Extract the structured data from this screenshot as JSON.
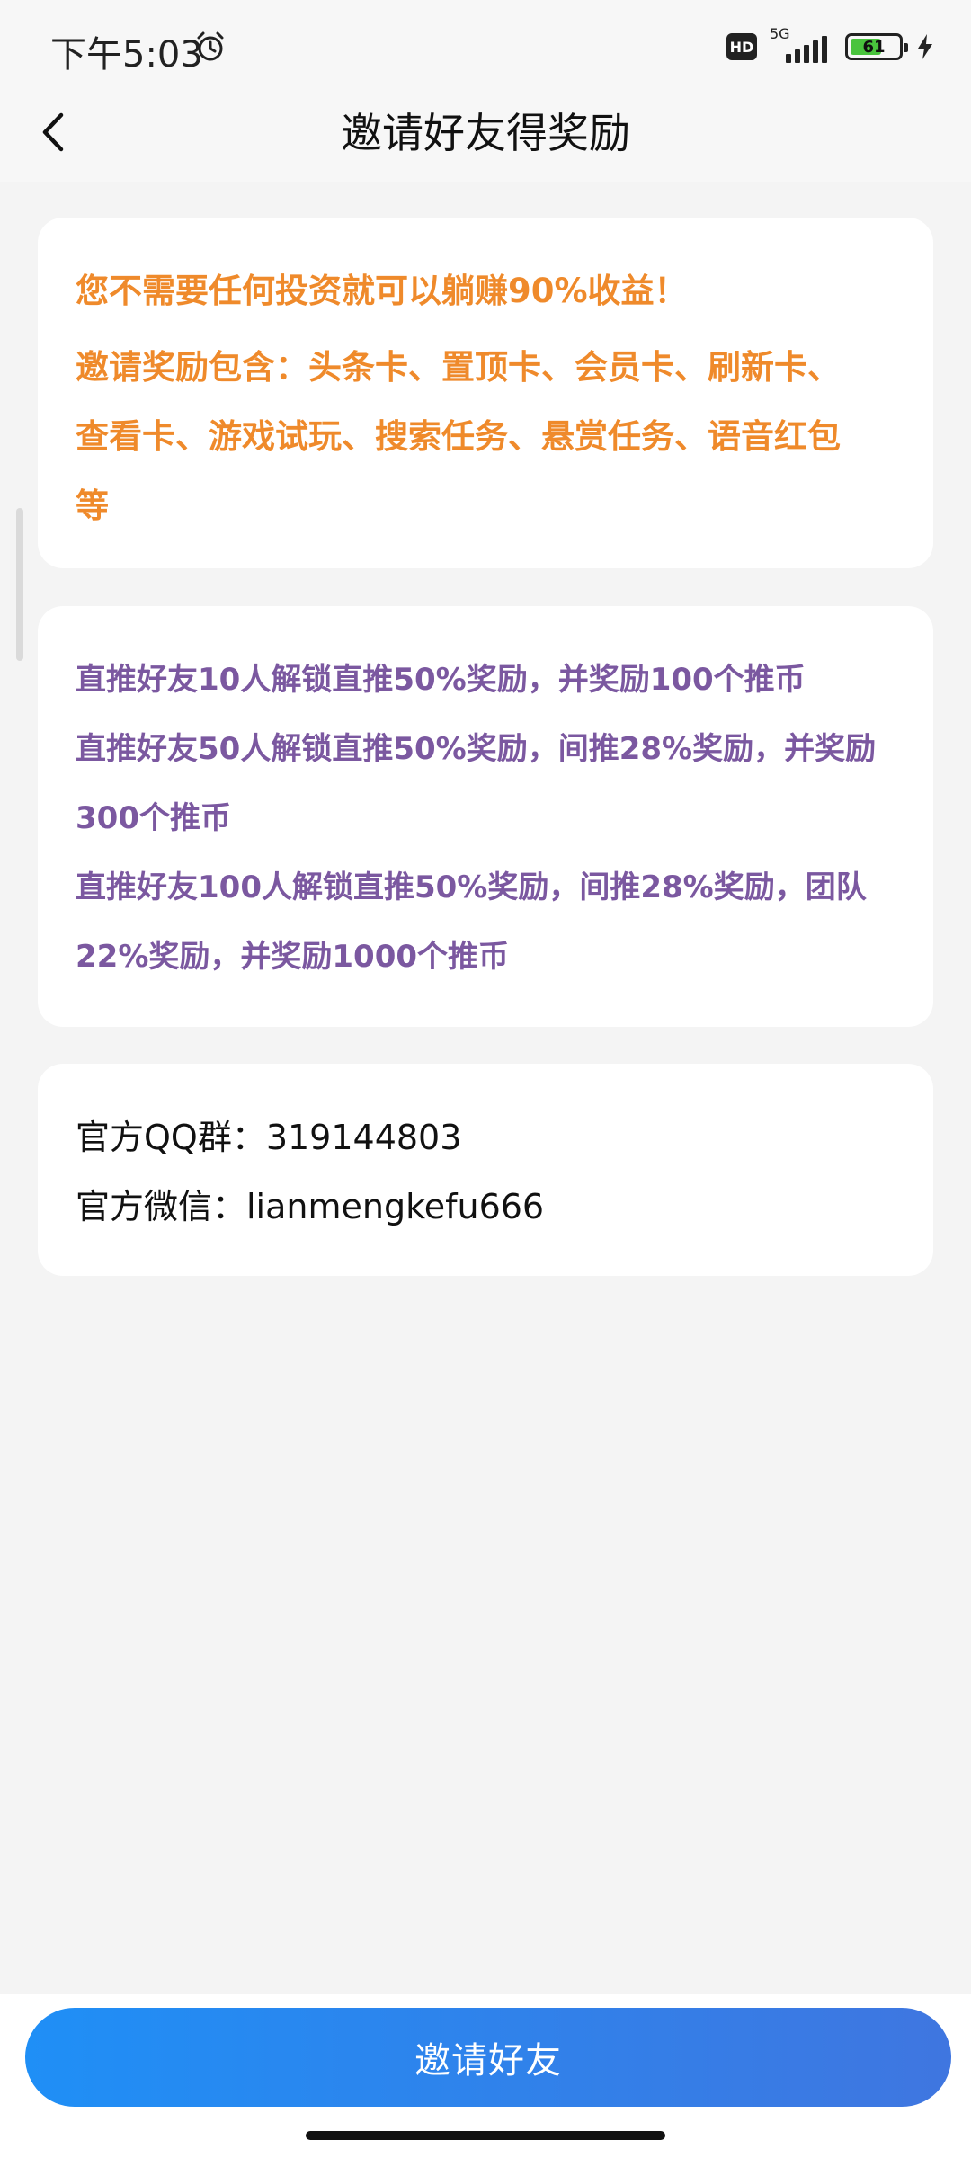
{
  "status_bar": {
    "time": "下午5:03",
    "hd_label": "HD",
    "network_label": "5G",
    "battery_level": "61"
  },
  "header": {
    "title": "邀请好友得奖励"
  },
  "card_intro": {
    "lines": [
      "您不需要任何投资就可以躺赚90%收益！",
      "邀请奖励包含：头条卡、置顶卡、会员卡、刷新卡、",
      "查看卡、游戏试玩、搜索任务、悬赏任务、语音红包",
      "等"
    ],
    "color": "#ef8a2b"
  },
  "card_rewards": {
    "lines": [
      "直推好友10人解锁直推50%奖励，并奖励100个推币",
      "直推好友50人解锁直推50%奖励，间推28%奖励，并奖励",
      "300个推币",
      "直推好友100人解锁直推50%奖励，间推28%奖励，团队",
      "22%奖励，并奖励1000个推币"
    ],
    "color": "#7b58a0"
  },
  "card_contact": {
    "qq_group": "官方QQ群：319144803",
    "wechat": "官方微信：lianmengkefu666"
  },
  "footer": {
    "invite_button_label": "邀请好友",
    "button_gradient": [
      "#1f8ff6",
      "#3f76e0"
    ]
  }
}
